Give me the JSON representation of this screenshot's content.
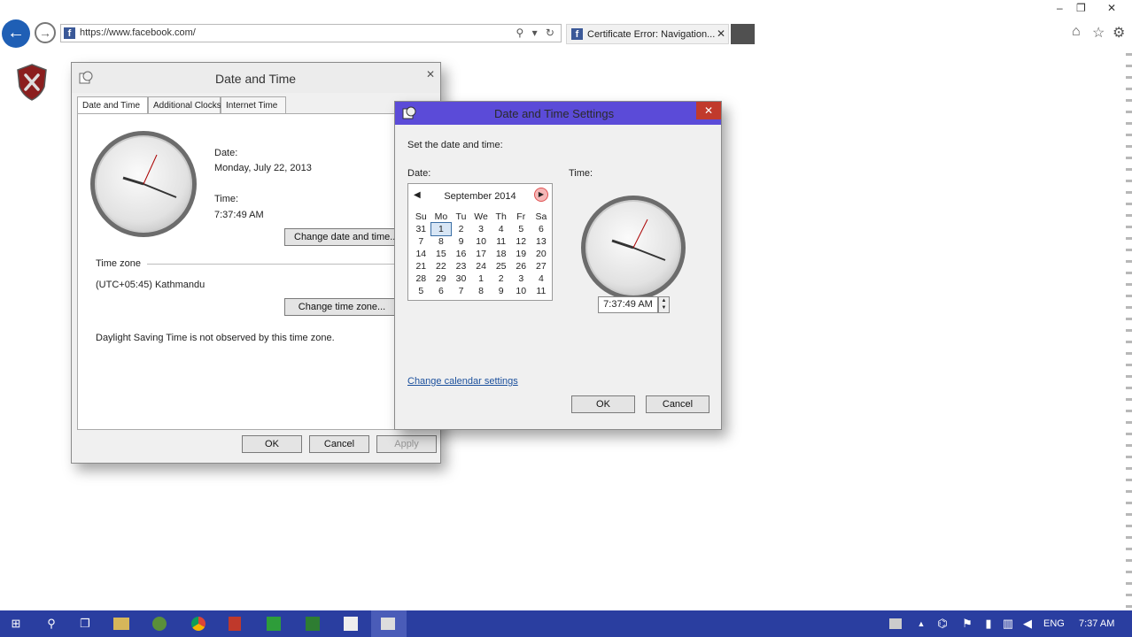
{
  "browser": {
    "url": "https://www.facebook.com/",
    "tab_title": "Certificate Error: Navigation...",
    "tab_favicon": "f",
    "back_icon": "←",
    "forward_icon": "→",
    "close_tab_icon": "✕",
    "address_icons": "⚲ ▾ ↻",
    "window_controls": {
      "minimize": "–",
      "restore": "❐",
      "close": "✕"
    },
    "nav_icons": {
      "home": "⌂",
      "favorites": "☆",
      "settings": "⚙"
    }
  },
  "date_time_dialog": {
    "title": "Date and Time",
    "close_icon": "✕",
    "tabs": [
      "Date and Time",
      "Additional Clocks",
      "Internet Time"
    ],
    "date_label": "Date:",
    "date_value": "Monday, July 22, 2013",
    "time_label": "Time:",
    "time_value": "7:37:49 AM",
    "change_datetime_button": "Change date and time...",
    "timezone_heading": "Time zone",
    "timezone_value": "(UTC+05:45) Kathmandu",
    "change_timezone_button": "Change time zone...",
    "dst_note": "Daylight Saving Time is not observed by this time zone.",
    "ok_button": "OK",
    "cancel_button": "Cancel",
    "apply_button": "Apply"
  },
  "settings_dialog": {
    "title": "Date and Time Settings",
    "close_icon": "✕",
    "instruction": "Set the date and time:",
    "date_label": "Date:",
    "time_label": "Time:",
    "calendar": {
      "month_year": "September 2014",
      "prev_icon": "◀",
      "next_icon": "▶",
      "weekdays": [
        "Su",
        "Mo",
        "Tu",
        "We",
        "Th",
        "Fr",
        "Sa"
      ],
      "weeks": [
        [
          "31",
          "1",
          "2",
          "3",
          "4",
          "5",
          "6"
        ],
        [
          "7",
          "8",
          "9",
          "10",
          "11",
          "12",
          "13"
        ],
        [
          "14",
          "15",
          "16",
          "17",
          "18",
          "19",
          "20"
        ],
        [
          "21",
          "22",
          "23",
          "24",
          "25",
          "26",
          "27"
        ],
        [
          "28",
          "29",
          "30",
          "1",
          "2",
          "3",
          "4"
        ],
        [
          "5",
          "6",
          "7",
          "8",
          "9",
          "10",
          "11"
        ]
      ],
      "selected_day": "1"
    },
    "time_value": "7:37:49 AM",
    "change_calendar_link": "Change calendar settings",
    "ok_button": "OK",
    "cancel_button": "Cancel"
  },
  "taskbar": {
    "language": "ENG",
    "clock": "7:37 AM",
    "start_icon": "⊞",
    "search_icon": "⚲",
    "task_view_icon": "❐"
  },
  "colors": {
    "taskbar": "#2a3ea0",
    "settings_titlebar": "#5b4bd8",
    "close_red": "#c13a2c",
    "back_button": "#1f5fb5",
    "link": "#1a4f9c"
  }
}
